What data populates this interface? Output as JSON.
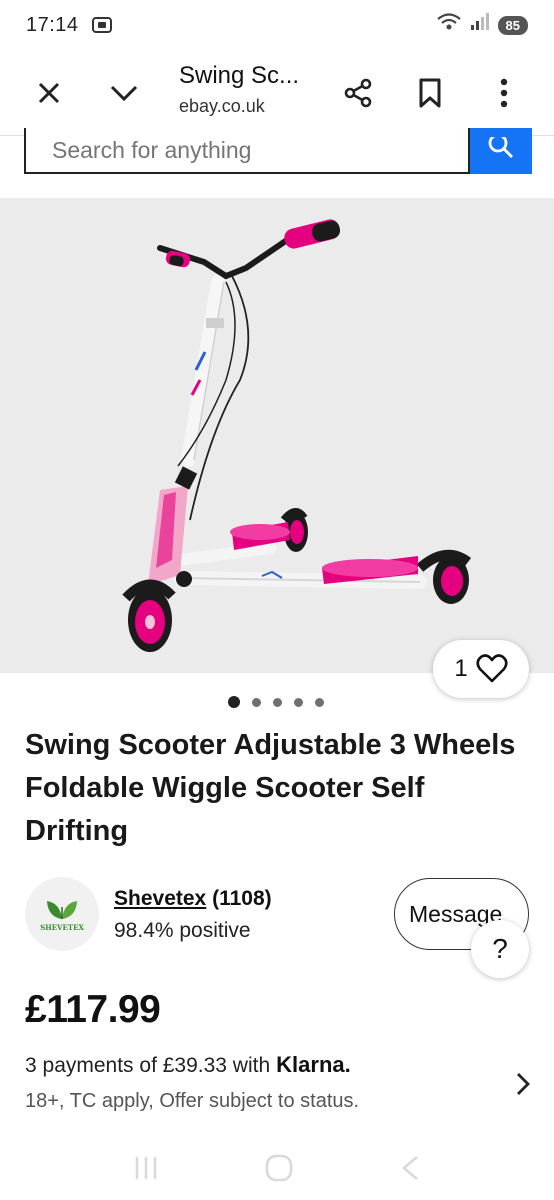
{
  "status_bar": {
    "time": "17:14",
    "battery": "85"
  },
  "toolbar": {
    "title": "Swing Sc...",
    "url": "ebay.co.uk"
  },
  "search": {
    "placeholder": "Search for anything"
  },
  "image": {
    "watch_count": "1",
    "dots_total": 5,
    "active_dot": 0
  },
  "product": {
    "title": "Swing Scooter Adjustable 3 Wheels Foldable Wiggle Scooter Self Drifting"
  },
  "seller": {
    "logo_text": "SHEVETEX",
    "name": "Shevetex",
    "feedback_count": "(1108)",
    "positive": "98.4% positive",
    "message_label": "Message",
    "help_label": "?"
  },
  "price": "£117.99",
  "klarna": {
    "text": "3 payments of £39.33 with",
    "brand": "Klarna.",
    "terms": "18+, TC apply, Offer subject to status."
  },
  "colors": {
    "accent_blue": "#1474f5",
    "scooter_pink": "#e4007f"
  }
}
